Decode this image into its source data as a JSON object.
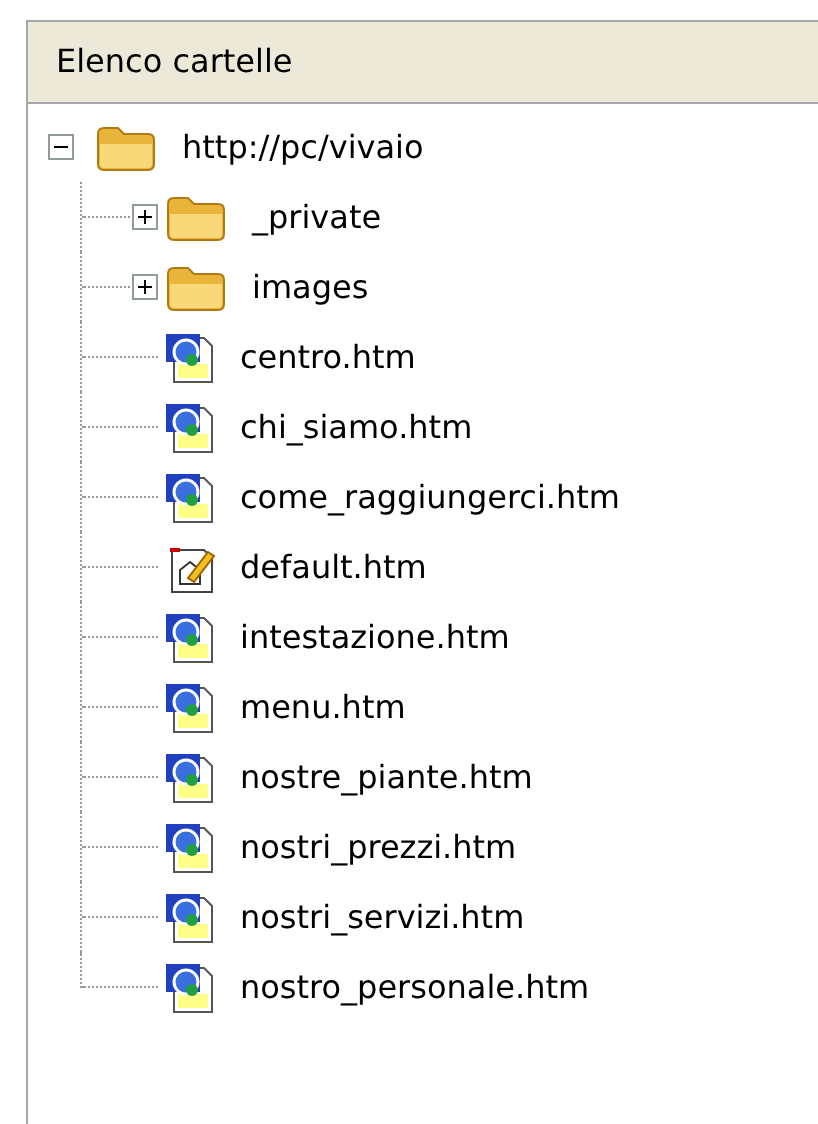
{
  "panel": {
    "title": "Elenco cartelle"
  },
  "tree": [
    {
      "label": "http://pc/vivaio",
      "kind": "folder",
      "expanded": true,
      "children": [
        {
          "label": "_private",
          "kind": "folder",
          "expanded": false
        },
        {
          "label": "images",
          "kind": "folder",
          "expanded": false
        },
        {
          "label": "centro.htm",
          "kind": "page"
        },
        {
          "label": "chi_siamo.htm",
          "kind": "page"
        },
        {
          "label": "come_raggiungerci.htm",
          "kind": "page"
        },
        {
          "label": "default.htm",
          "kind": "home"
        },
        {
          "label": "intestazione.htm",
          "kind": "page"
        },
        {
          "label": "menu.htm",
          "kind": "page"
        },
        {
          "label": "nostre_piante.htm",
          "kind": "page"
        },
        {
          "label": "nostri_prezzi.htm",
          "kind": "page"
        },
        {
          "label": "nostri_servizi.htm",
          "kind": "page"
        },
        {
          "label": "nostro_personale.htm",
          "kind": "page"
        }
      ]
    }
  ]
}
